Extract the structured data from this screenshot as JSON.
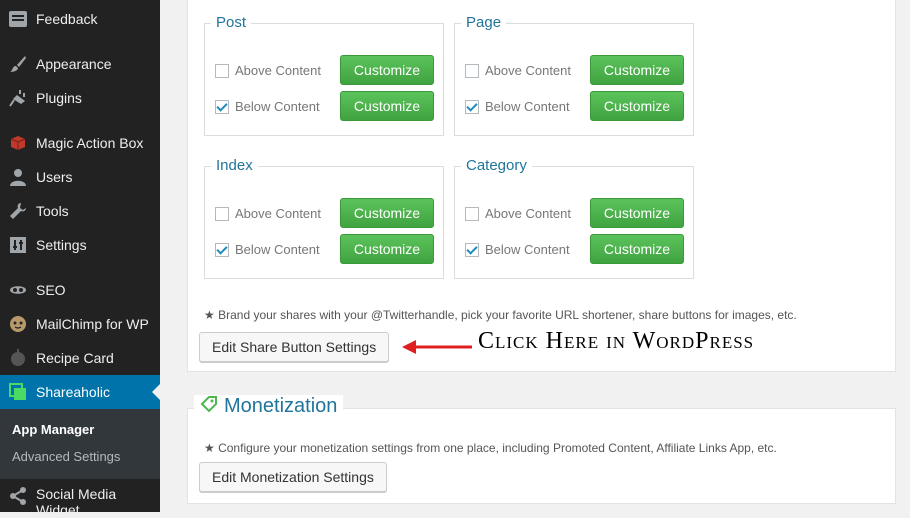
{
  "sidebar": {
    "items": [
      {
        "label": "Feedback",
        "icon": "feedback-icon"
      },
      {
        "label": "Appearance",
        "icon": "paintbrush-icon"
      },
      {
        "label": "Plugins",
        "icon": "plug-icon"
      },
      {
        "label": "Magic Action Box",
        "icon": "box-icon"
      },
      {
        "label": "Users",
        "icon": "user-icon"
      },
      {
        "label": "Tools",
        "icon": "wrench-icon"
      },
      {
        "label": "Settings",
        "icon": "sliders-icon"
      },
      {
        "label": "SEO",
        "icon": "seo-icon"
      },
      {
        "label": "MailChimp for WP",
        "icon": "mailchimp-icon"
      },
      {
        "label": "Recipe Card",
        "icon": "recipe-icon"
      },
      {
        "label": "Shareaholic",
        "icon": "shareaholic-icon"
      },
      {
        "label": "Social Media Widget",
        "icon": "share-icon"
      }
    ],
    "submenu": [
      "App Manager",
      "Advanced Settings"
    ]
  },
  "share_buttons": {
    "groups": [
      {
        "title": "Post",
        "above_label": "Above Content",
        "above_checked": false,
        "below_label": "Below Content",
        "below_checked": true,
        "customize_label": "Customize"
      },
      {
        "title": "Page",
        "above_label": "Above Content",
        "above_checked": false,
        "below_label": "Below Content",
        "below_checked": true,
        "customize_label": "Customize"
      },
      {
        "title": "Index",
        "above_label": "Above Content",
        "above_checked": false,
        "below_label": "Below Content",
        "below_checked": true,
        "customize_label": "Customize"
      },
      {
        "title": "Category",
        "above_label": "Above Content",
        "above_checked": false,
        "below_label": "Below Content",
        "below_checked": true,
        "customize_label": "Customize"
      }
    ],
    "note": "★ Brand your shares with your @Twitterhandle, pick your favorite URL shortener, share buttons for images, etc.",
    "edit_button": "Edit Share Button Settings",
    "annotation": "Click Here in WordPress"
  },
  "monetization": {
    "title": "Monetization",
    "icon": "tag-icon",
    "note": "★ Configure your monetization settings from one place, including Promoted Content, Affiliate Links App, etc.",
    "edit_button": "Edit Monetization Settings"
  },
  "colors": {
    "accent": "#0073aa",
    "green": "#4cb84c",
    "title_blue": "#21759b",
    "annotation_arrow": "#e02020"
  }
}
